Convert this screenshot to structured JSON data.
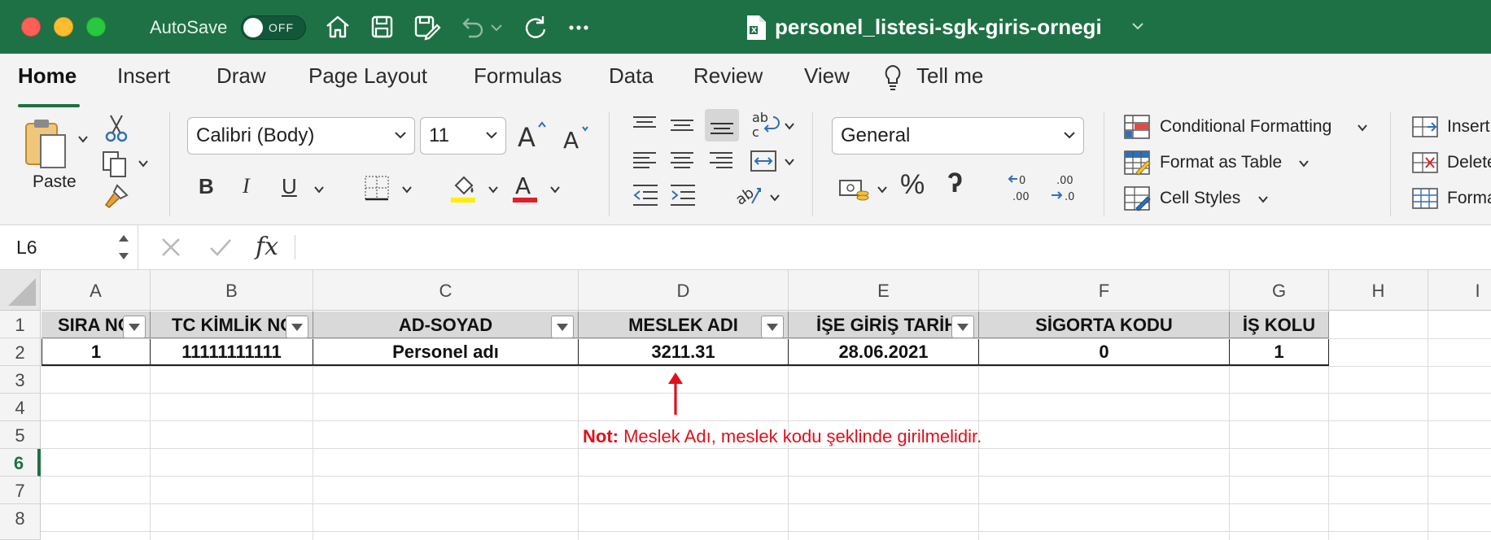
{
  "titlebar": {
    "autosave_label": "AutoSave",
    "autosave_state": "OFF",
    "document_title": "personel_listesi-sgk-giris-ornegi",
    "icons": [
      "home-icon",
      "save-icon",
      "save-as-icon",
      "undo-icon",
      "redo-icon",
      "more-icon"
    ]
  },
  "ribbon": {
    "tabs": [
      "Home",
      "Insert",
      "Draw",
      "Page Layout",
      "Formulas",
      "Data",
      "Review",
      "View"
    ],
    "tell_me": "Tell me",
    "paste_label": "Paste",
    "font_name": "Calibri (Body)",
    "font_size": "11",
    "number_format": "General",
    "conditional_formatting": "Conditional Formatting",
    "format_as_table": "Format as Table",
    "cell_styles": "Cell Styles",
    "insert": "Insert",
    "delete": "Delete",
    "format": "Format",
    "bold": "B",
    "italic": "I",
    "underline": "U",
    "percent": "%",
    "comma": "ʔ"
  },
  "formula_bar": {
    "name_box": "L6",
    "fx": "fx",
    "content": ""
  },
  "sheet": {
    "columns": [
      "A",
      "B",
      "C",
      "D",
      "E",
      "F",
      "G",
      "H",
      "I"
    ],
    "rows": [
      "1",
      "2",
      "3",
      "4",
      "5",
      "6",
      "7",
      "8"
    ],
    "selected_row": "6",
    "header_row": [
      "SIRA NO",
      "TC KİMLİK NO",
      "AD-SOYAD",
      "MESLEK ADI",
      "İŞE GİRİŞ TARİHİ",
      "SİGORTA KODU",
      "İŞ KOLU"
    ],
    "data_row": [
      "1",
      "11111111111",
      "Personel adı",
      "3211.31",
      "28.06.2021",
      "0",
      "1"
    ],
    "note_bold": "Not:",
    "note_text": " Meslek Adı, meslek kodu şeklinde girilmelidir.",
    "accent_color": "#1e7145",
    "note_color": "#e0101a"
  }
}
